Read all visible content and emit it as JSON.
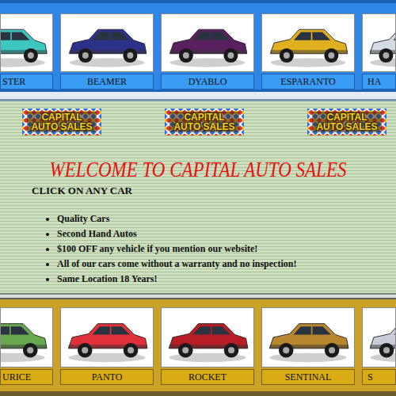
{
  "top_cars": [
    {
      "label": "STER",
      "color": "#3ec6c1"
    },
    {
      "label": "BEAMER",
      "color": "#2c318a"
    },
    {
      "label": "DYABLO",
      "color": "#5a1f5e"
    },
    {
      "label": "ESPARANTO",
      "color": "#e0b020"
    },
    {
      "label": "HA",
      "color": "#d4dbe2"
    }
  ],
  "logos": [
    {
      "text": "CAPITAL AUTO SALES"
    },
    {
      "text": "CAPITAL AUTO SALES"
    },
    {
      "text": "CAPITAL AUTO SALES"
    }
  ],
  "heading": "WELCOME TO CAPITAL AUTO SALES",
  "instruction": "CLICK ON ANY CAR",
  "features": [
    "Quality Cars",
    "Second Hand Autos",
    "$100 OFF any vehicle if you mention our website!",
    "All of our cars come without a warranty and no inspection!",
    "Same Location 18 Years!"
  ],
  "bottom_cars": [
    {
      "label": "URICE",
      "color": "#6aa84f"
    },
    {
      "label": "PANTO",
      "color": "#e0303a"
    },
    {
      "label": "ROCKET",
      "color": "#b81c24"
    },
    {
      "label": "SENTINAL",
      "color": "#b8862e"
    },
    {
      "label": "S",
      "color": "#c8ccd8"
    }
  ]
}
